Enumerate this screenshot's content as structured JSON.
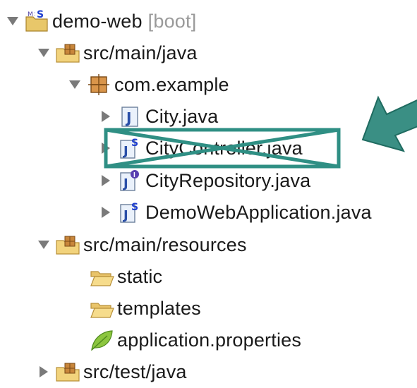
{
  "tree": {
    "project": {
      "name": "demo-web",
      "tag": "[boot]"
    },
    "src_main_java": "src/main/java",
    "package": "com.example",
    "files": [
      "City.java",
      "CityController.java",
      "CityRepository.java",
      "DemoWebApplication.java"
    ],
    "src_main_resources": "src/main/resources",
    "folders": [
      "static",
      "templates"
    ],
    "properties_file": "application.properties",
    "src_test_java": "src/test/java"
  },
  "colors": {
    "annotation": "#2f8f84",
    "text": "#1a1a1a",
    "muted": "#9a9a9a"
  },
  "icons": {
    "project": "maven-spring-project-icon",
    "source_folder": "package-folder-icon",
    "package": "package-icon",
    "java_class": "java-class-icon",
    "spring_class": "spring-java-icon",
    "interface": "java-interface-icon",
    "folder": "folder-icon",
    "properties": "leaf-icon"
  }
}
